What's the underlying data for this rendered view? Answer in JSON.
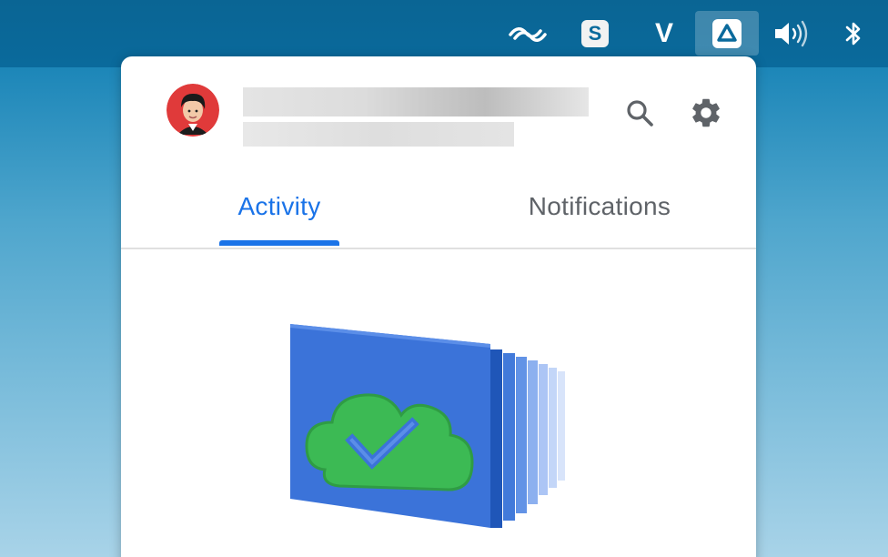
{
  "menubar": {
    "tray_icons": [
      {
        "name": "wave-app-icon"
      },
      {
        "name": "skype-icon",
        "letter": "S"
      },
      {
        "name": "vimeo-icon",
        "letter": "V"
      },
      {
        "name": "google-drive-icon",
        "active": true
      },
      {
        "name": "volume-icon"
      },
      {
        "name": "bluetooth-icon"
      }
    ]
  },
  "panel": {
    "account": {
      "avatar_icon": "user-avatar"
    },
    "header_actions": [
      {
        "name": "search-icon"
      },
      {
        "name": "gear-icon"
      }
    ],
    "tabs": {
      "activity_label": "Activity",
      "notifications_label": "Notifications",
      "active": "Activity"
    },
    "illustration": "cloud-sync-complete"
  },
  "colors": {
    "accent": "#1a73e8",
    "menubar": "#0a6a9c",
    "tab_inactive": "#5f6368",
    "cloud_green": "#3cba54"
  }
}
